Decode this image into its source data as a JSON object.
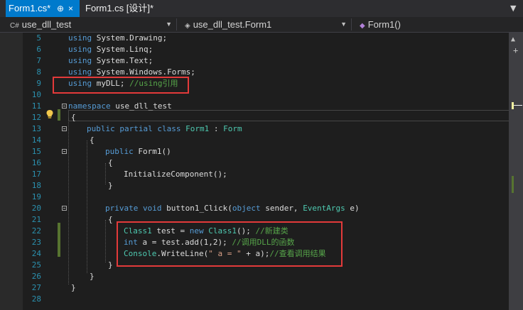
{
  "tabs": [
    {
      "label": "Form1.cs*",
      "pin": "⊕",
      "close": "×"
    },
    {
      "label": "Form1.cs [设计]*"
    }
  ],
  "navbar": {
    "project": "use_dll_test",
    "class": "use_dll_test.Form1",
    "member": "Form1()"
  },
  "code": {
    "l5": {
      "num": "5",
      "kw": "using",
      "rest": " System.Drawing;"
    },
    "l6": {
      "num": "6",
      "kw": "using",
      "rest": " System.Linq;"
    },
    "l7": {
      "num": "7",
      "kw": "using",
      "rest": " System.Text;"
    },
    "l8": {
      "num": "8",
      "kw": "using",
      "rest": " System.Windows.Forms;"
    },
    "l9": {
      "num": "9",
      "kw": "using",
      "rest": " myDLL;",
      "comment": " //using引用"
    },
    "l10": {
      "num": "10"
    },
    "l11": {
      "num": "11",
      "kw": "namespace",
      "rest": " use_dll_test"
    },
    "l12": {
      "num": "12",
      "rest": "{"
    },
    "l13": {
      "num": "13",
      "kw1": "public",
      "kw2": " partial",
      "kw3": " class",
      "type1": " Form1",
      "sep": " : ",
      "type2": "Form"
    },
    "l14": {
      "num": "14",
      "rest": "{"
    },
    "l15": {
      "num": "15",
      "kw": "public",
      "rest": " Form1()"
    },
    "l16": {
      "num": "16",
      "rest": "{"
    },
    "l17": {
      "num": "17",
      "rest": "InitializeComponent();"
    },
    "l18": {
      "num": "18",
      "rest": "}"
    },
    "l19": {
      "num": "19"
    },
    "l20": {
      "num": "20",
      "kw1": "private",
      "kw2": " void",
      "rest1": " button1_Click(",
      "kw3": "object",
      "rest2": " sender, ",
      "type": "EventArgs",
      "rest3": " e)"
    },
    "l21": {
      "num": "21",
      "rest": "{"
    },
    "l22": {
      "num": "22",
      "type1": "Class1",
      "rest1": " test = ",
      "kw": "new",
      "type2": " Class1",
      "rest2": "(); ",
      "comment": "//新建类"
    },
    "l23": {
      "num": "23",
      "kw": "int",
      "rest": " a = test.add(1,2); ",
      "comment": "//调用DLL的函数"
    },
    "l24": {
      "num": "24",
      "type": "Console",
      "rest1": ".WriteLine(",
      "str": "\" a = \"",
      "rest2": " + a);",
      "comment": "//查看调用结果"
    },
    "l25": {
      "num": "25",
      "rest": "}"
    },
    "l26": {
      "num": "26",
      "rest": "}"
    },
    "l27": {
      "num": "27",
      "rest": "}"
    },
    "l28": {
      "num": "28"
    }
  },
  "colors": {
    "accent": "#007acc",
    "highlight": "#e33a3a",
    "keyword": "#569cd6",
    "type": "#4ec9b0",
    "comment": "#57a64a",
    "string": "#d69d85",
    "line_number": "#2b91af"
  }
}
